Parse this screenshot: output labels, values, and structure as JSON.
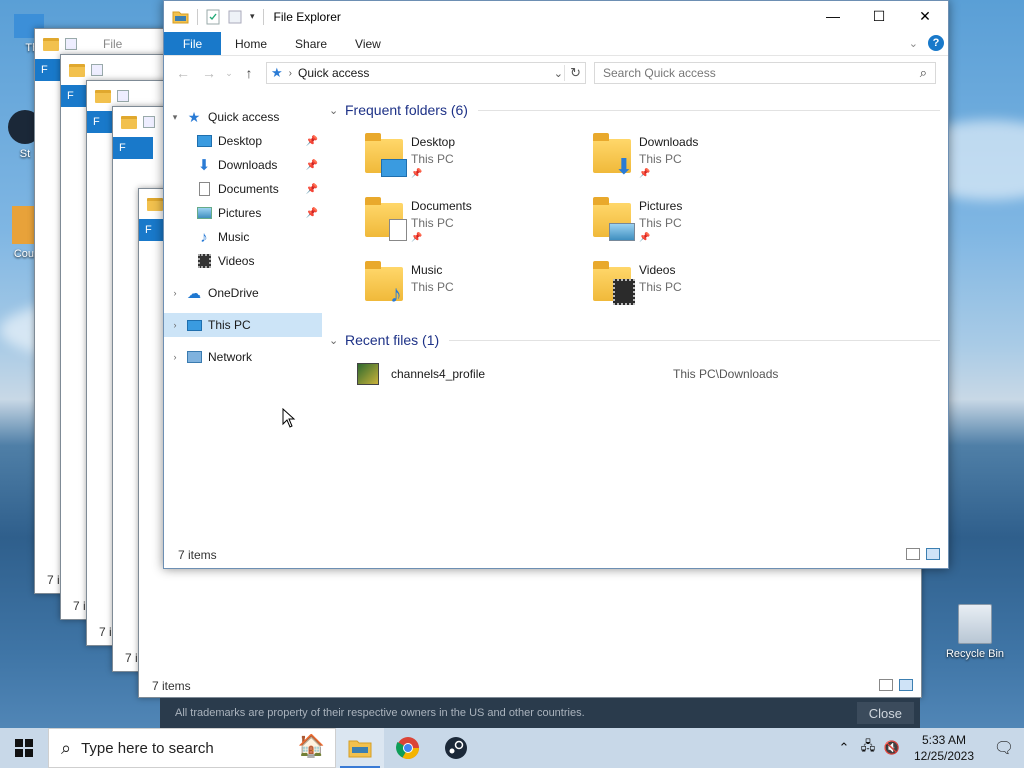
{
  "desktop": {
    "icons": [
      {
        "label": "Thi"
      },
      {
        "label": "St"
      },
      {
        "label": "Coun"
      },
      {
        "label": "Recycle Bin"
      }
    ]
  },
  "background_windows": {
    "file_tab": "F",
    "items_label": "7 i",
    "title_peek": "File"
  },
  "explorer": {
    "title": "File Explorer",
    "controls": {
      "minimize": "—",
      "maximize": "☐",
      "close": "✕"
    },
    "ribbon": {
      "tabs": [
        "File",
        "Home",
        "Share",
        "View"
      ],
      "help": "?"
    },
    "address": {
      "location": "Quick access"
    },
    "search": {
      "placeholder": "Search Quick access"
    },
    "nav": {
      "quick_access": "Quick access",
      "pinned": [
        "Desktop",
        "Downloads",
        "Documents",
        "Pictures"
      ],
      "unpinned": [
        "Music",
        "Videos"
      ],
      "onedrive": "OneDrive",
      "this_pc": "This PC",
      "network": "Network"
    },
    "frequent_header": "Frequent folders (6)",
    "folders": [
      {
        "name": "Desktop",
        "location": "This PC",
        "pinned": true,
        "icon": "desktop-folder-icon"
      },
      {
        "name": "Downloads",
        "location": "This PC",
        "pinned": true,
        "icon": "downloads-folder-icon"
      },
      {
        "name": "Documents",
        "location": "This PC",
        "pinned": true,
        "icon": "documents-folder-icon"
      },
      {
        "name": "Pictures",
        "location": "This PC",
        "pinned": true,
        "icon": "pictures-folder-icon"
      },
      {
        "name": "Music",
        "location": "This PC",
        "pinned": false,
        "icon": "music-folder-icon"
      },
      {
        "name": "Videos",
        "location": "This PC",
        "pinned": false,
        "icon": "videos-folder-icon"
      }
    ],
    "recent_header": "Recent files (1)",
    "recent": [
      {
        "name": "channels4_profile",
        "path": "This PC\\Downloads"
      }
    ],
    "status": "7 items"
  },
  "explorer_behind": {
    "status": "7 items"
  },
  "steam_banner": {
    "text": "All trademarks are property of their respective owners in the US and other countries.",
    "close": "Close"
  },
  "taskbar": {
    "search_placeholder": "Type here to search",
    "time": "5:33 AM",
    "date": "12/25/2023"
  },
  "colors": {
    "accent": "#1979ca",
    "selection": "#cce4f7",
    "group_header": "#1e3287"
  }
}
